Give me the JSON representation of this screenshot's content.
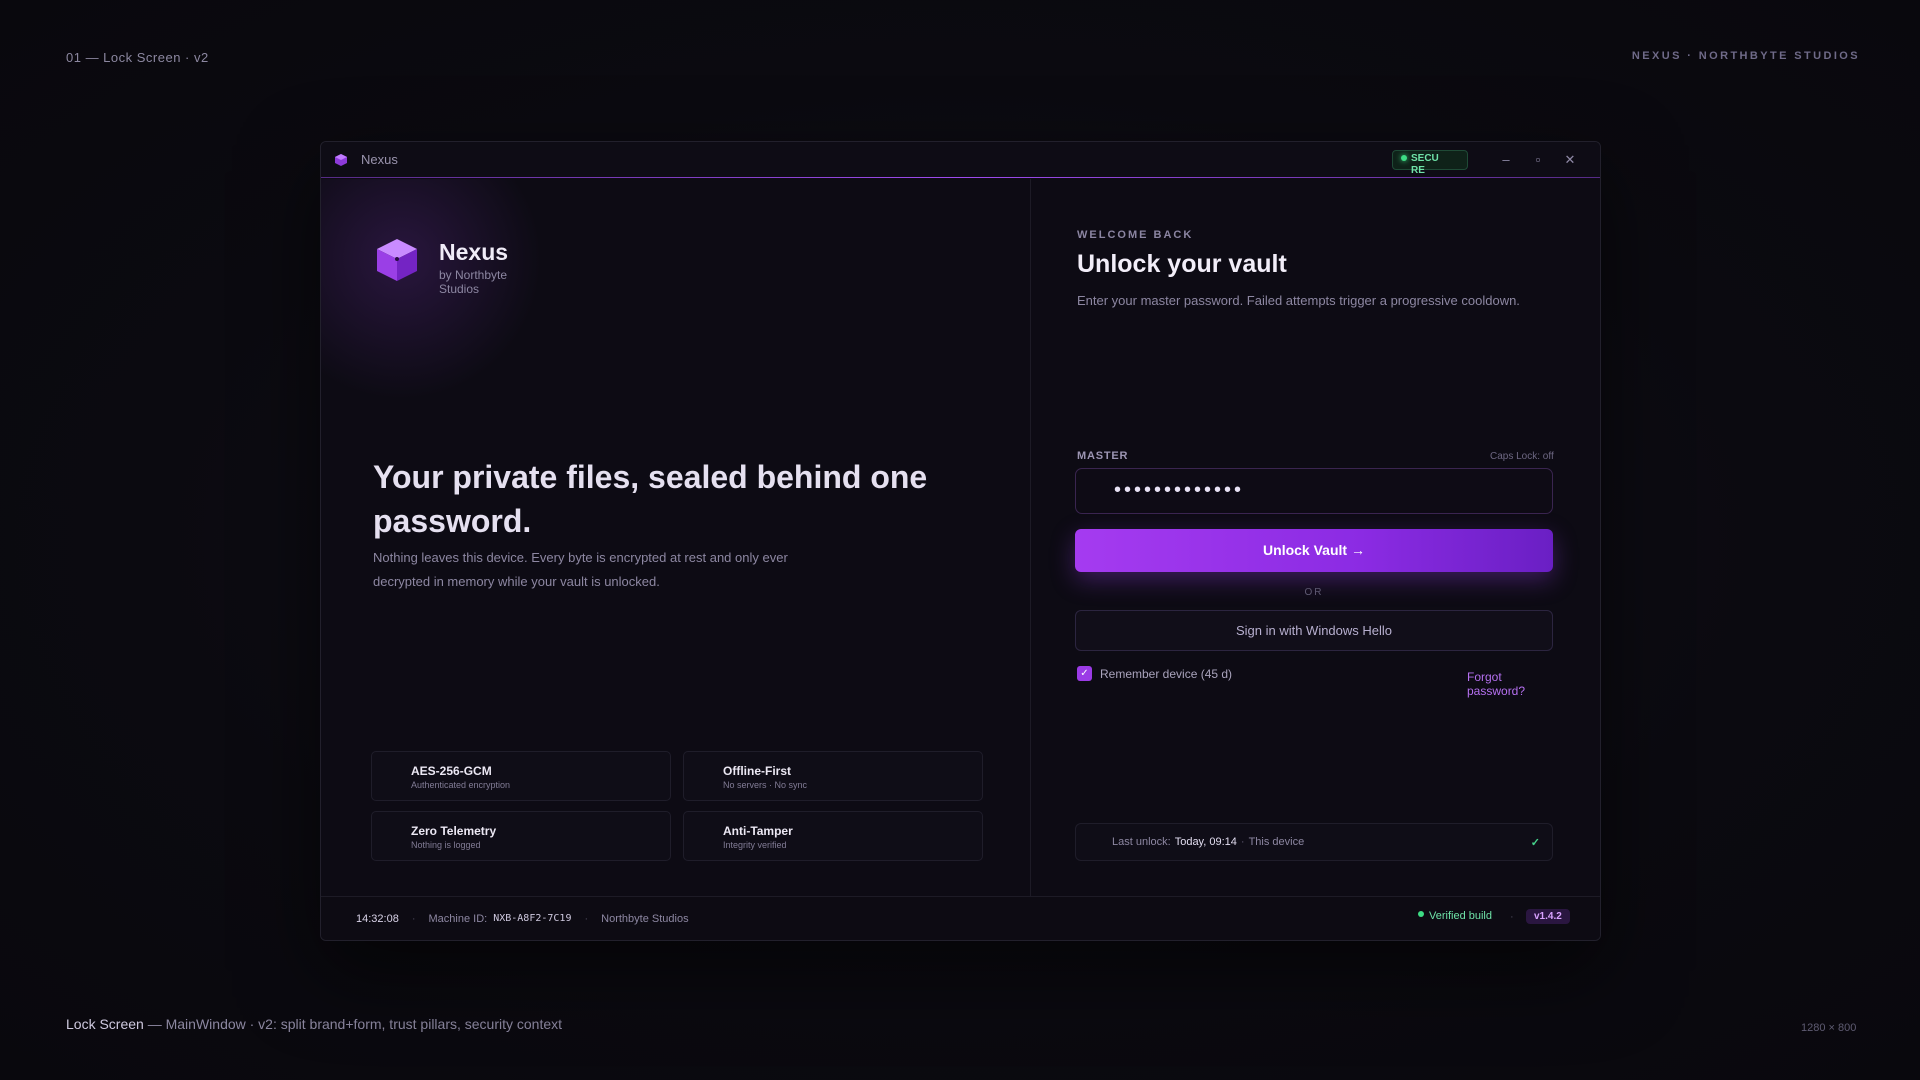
{
  "meta": {
    "top_left": "01 — Lock Screen · v2",
    "top_right": "NEXUS · NORTHBYTE STUDIOS",
    "bottom_left_strong": "Lock Screen",
    "bottom_left_rest": " — MainWindow · v2: split brand+form, trust pillars, security context",
    "bottom_right": "1280 × 800"
  },
  "titlebar": {
    "title": "Nexus",
    "secure_badge": "SECURE",
    "minimize": "–",
    "maximize": "▫",
    "close": "✕"
  },
  "brand": {
    "name": "Nexus",
    "sub": "by Northbyte Studios"
  },
  "hero": {
    "title": "Your private files, sealed behind one password.",
    "subtitle": "Nothing leaves this device. Every byte is encrypted at rest and only ever decrypted in memory while your vault is unlocked."
  },
  "pillars": [
    {
      "name": "AES-256-GCM",
      "desc": "Authenticated encryption"
    },
    {
      "name": "Offline-First",
      "desc": "No servers · No sync"
    },
    {
      "name": "Zero Telemetry",
      "desc": "Nothing is logged"
    },
    {
      "name": "Anti-Tamper",
      "desc": "Integrity verified"
    }
  ],
  "form": {
    "welcome": "WELCOME BACK",
    "title": "Unlock your vault",
    "subtitle": "Enter your master password. Failed attempts trigger a progressive cooldown.",
    "password_label": "MASTER PASSWORD",
    "caps_lock": "Caps Lock: off",
    "password_value": "•••••••••••••",
    "unlock_button": "Unlock Vault →",
    "or": "OR",
    "hello_button": "Sign in with Windows Hello",
    "remember_label": "Remember device (45 d)",
    "remember_check": "✓",
    "forgot": "Forgot password?"
  },
  "last_unlock": {
    "label": "Last unlock:",
    "time": "Today, 09:14",
    "sep": "·",
    "device": "This device",
    "check": "✓"
  },
  "status": {
    "time": "14:32:08",
    "machine_label": "Machine ID:",
    "machine_id": "NXB-A8F2-7C19",
    "company": "Northbyte Studios",
    "verified": "Verified build",
    "version": "v1.4.2",
    "sep": "·"
  },
  "colors": {
    "accent": "#a53bf0",
    "secure": "#3ddc84",
    "background": "#0d0b14"
  }
}
